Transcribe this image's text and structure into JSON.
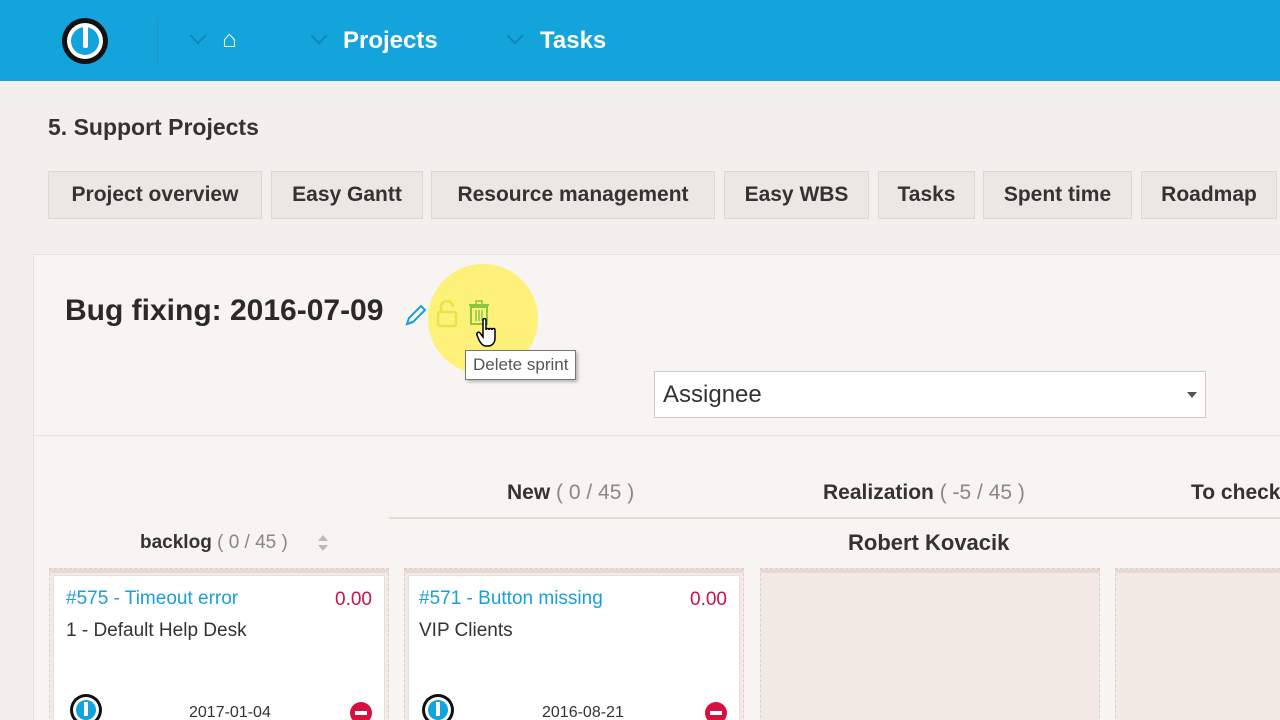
{
  "topbar": {
    "logo_icon": "power-logo-icon",
    "home_icon": "home-icon",
    "home_glyph": "⌂",
    "nav": [
      {
        "label": "Projects"
      },
      {
        "label": "Tasks"
      }
    ]
  },
  "project": {
    "title": "5. Support Projects"
  },
  "tabs": [
    {
      "label": "Project overview"
    },
    {
      "label": "Easy Gantt"
    },
    {
      "label": "Resource management"
    },
    {
      "label": "Easy WBS"
    },
    {
      "label": "Tasks"
    },
    {
      "label": "Spent time"
    },
    {
      "label": "Roadmap"
    }
  ],
  "sprint": {
    "title": "Bug fixing: 2016-07-09",
    "tooltip": "Delete sprint",
    "icons": [
      "pencil-icon",
      "lock-icon",
      "trash-icon"
    ]
  },
  "swimlane_select": {
    "value": "Assignee"
  },
  "columns": [
    {
      "name": "New",
      "count": "( 0 / 45 )"
    },
    {
      "name": "Realization",
      "count": "( -5 / 45 )"
    },
    {
      "name": "To check",
      "count": ""
    }
  ],
  "backlog": {
    "name": "backlog",
    "count": "( 0 / 45 )"
  },
  "assignee": {
    "name": "Robert Kovacik"
  },
  "cards": [
    {
      "link": "#575 - Timeout error",
      "points": "0.00",
      "project": "1 - Default Help Desk",
      "date": "2017-01-04"
    },
    {
      "link": "#571 - Button missing",
      "points": "0.00",
      "project": "VIP Clients",
      "date": "2016-08-21"
    }
  ],
  "colors": {
    "topbar": "#12a4db",
    "link": "#1a9fd8",
    "points": "#cc1144",
    "remove": "#d6103f",
    "background": "#f2efec"
  }
}
